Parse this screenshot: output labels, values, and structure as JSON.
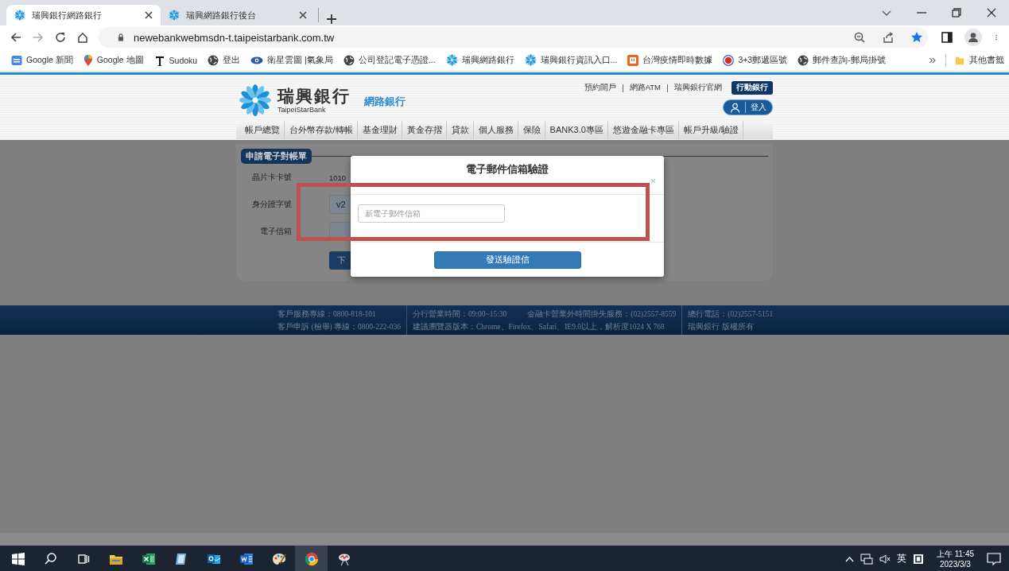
{
  "browser": {
    "tabs": [
      {
        "title": "瑞興銀行網路銀行",
        "selected": true
      },
      {
        "title": "瑞興網路銀行後台",
        "selected": false
      }
    ],
    "url": "newebankwebmsdn-t.taipeistarbank.com.tw",
    "bookmarks": [
      {
        "label": "Google 新聞",
        "kind": "news"
      },
      {
        "label": "Google 地圖",
        "kind": "pin"
      },
      {
        "label": "Sudoku",
        "kind": "serif"
      },
      {
        "label": "登出",
        "kind": "globe"
      },
      {
        "label": "衛星雲圖 |氣象局",
        "kind": "eye"
      },
      {
        "label": "公司登記電子憑證...",
        "kind": "globe"
      },
      {
        "label": "瑞興網路銀行",
        "kind": "flower"
      },
      {
        "label": "瑞興銀行資訊入口...",
        "kind": "flower"
      },
      {
        "label": "台灣疫情即時數據",
        "kind": "outlet"
      },
      {
        "label": "3+3郵遞區號",
        "kind": "seal"
      },
      {
        "label": "郵件查詢-郵局掛號",
        "kind": "globe"
      }
    ],
    "other_bookmarks": "其他書籤"
  },
  "site": {
    "brand": "瑞興銀行",
    "brand_en": "TaipeiStarBank",
    "product": "網路銀行",
    "top_links": [
      "預約開戶",
      "網路ATM",
      "瑞興銀行官網"
    ],
    "mobile_button": "行動銀行",
    "login_button": "登入",
    "nav": [
      "帳戶總覽",
      "台外幣存款/轉帳",
      "基金理財",
      "黃金存摺",
      "貸款",
      "個人服務",
      "保險",
      "BANK3.0專區",
      "悠遊金融卡專區",
      "帳戶升級/驗證"
    ]
  },
  "form": {
    "title": "申請電子對帳單",
    "fields": [
      {
        "label": "晶片卡卡號",
        "kind": "text",
        "value": "1010"
      },
      {
        "label": "身分證字號",
        "kind": "input",
        "value": "v2"
      },
      {
        "label": "電子信箱",
        "kind": "input"
      }
    ],
    "button": "下"
  },
  "modal": {
    "title": "電子郵件信箱驗證",
    "close": "×",
    "email_field": {
      "placeholder": "新電子郵件信箱"
    },
    "button": "發送驗證信"
  },
  "footer": {
    "columns": [
      [
        [
          "客戶服務專線：0800-818-101"
        ],
        [
          "客戶申訴 (檢舉) 專線：0800-222-036"
        ]
      ],
      [
        [
          "分行營業時間：09:00~15:30",
          "金融卡營業外時間掛失服務：(02)2557-8559"
        ],
        [
          "建議瀏覽器版本：Chrome、Firefox、Safari、IE9.0以上，解析度1024 X 768"
        ]
      ],
      [
        [
          "總行電話：(02)2557-5151"
        ],
        [
          "瑞興銀行 版權所有"
        ]
      ]
    ]
  },
  "taskbar": {
    "ime": "英",
    "time": "上午 11:45",
    "date": "2023/3/3"
  }
}
